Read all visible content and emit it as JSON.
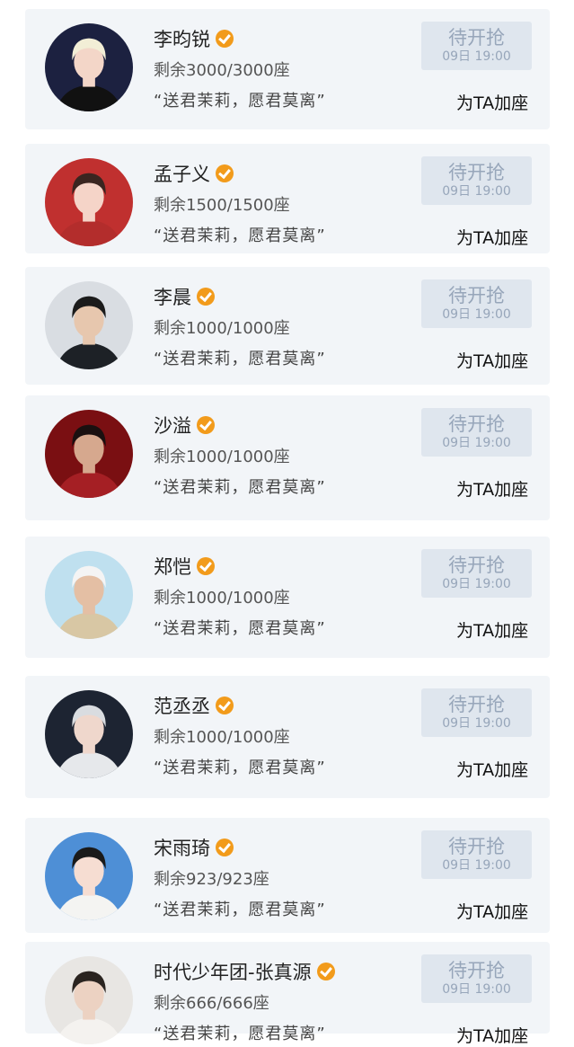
{
  "cards": [
    {
      "name": "李昀锐",
      "seats": "剩余3000/3000座",
      "quote": "“送君茉莉，愿君莫离”",
      "button": "待开抢",
      "time": "09日 19:00",
      "add": "为TA加座",
      "avatar": {
        "bg": "#1c2140",
        "hair": "#f2eed6",
        "skin": "#f3d6c8",
        "cloth": "#111111"
      }
    },
    {
      "name": "孟子义",
      "seats": "剩余1500/1500座",
      "quote": "“送君茉莉，愿君莫离”",
      "button": "待开抢",
      "time": "09日 19:00",
      "add": "为TA加座",
      "avatar": {
        "bg": "#c0302f",
        "hair": "#3a2520",
        "skin": "#f5d4c8",
        "cloth": "#b32d2c"
      }
    },
    {
      "name": "李晨",
      "seats": "剩余1000/1000座",
      "quote": "“送君茉莉，愿君莫离”",
      "button": "待开抢",
      "time": "09日 19:00",
      "add": "为TA加座",
      "avatar": {
        "bg": "#d9dde2",
        "hair": "#1b1b1b",
        "skin": "#e7c7ae",
        "cloth": "#1d2126"
      }
    },
    {
      "name": "沙溢",
      "seats": "剩余1000/1000座",
      "quote": "“送君茉莉，愿君莫离”",
      "button": "待开抢",
      "time": "09日 19:00",
      "add": "为TA加座",
      "avatar": {
        "bg": "#7a0f12",
        "hair": "#1a1010",
        "skin": "#d6a88e",
        "cloth": "#a51f24"
      }
    },
    {
      "name": "郑恺",
      "seats": "剩余1000/1000座",
      "quote": "“送君茉莉，愿君莫离”",
      "button": "待开抢",
      "time": "09日 19:00",
      "add": "为TA加座",
      "avatar": {
        "bg": "#bfe0ef",
        "hair": "#f4f4f4",
        "skin": "#e4bfa4",
        "cloth": "#d8c7a4"
      }
    },
    {
      "name": "范丞丞",
      "seats": "剩余1000/1000座",
      "quote": "“送君茉莉，愿君莫离”",
      "button": "待开抢",
      "time": "09日 19:00",
      "add": "为TA加座",
      "avatar": {
        "bg": "#1d2432",
        "hair": "#d9dce0",
        "skin": "#efd7cc",
        "cloth": "#e6e8eb"
      }
    },
    {
      "name": "宋雨琦",
      "seats": "剩余923/923座",
      "quote": "“送君茉莉，愿君莫离”",
      "button": "待开抢",
      "time": "09日 19:00",
      "add": "为TA加座",
      "avatar": {
        "bg": "#4e8fd6",
        "hair": "#1a1a1a",
        "skin": "#f6ddd2",
        "cloth": "#f4f4f2"
      }
    },
    {
      "name": "时代少年团-张真源",
      "seats": "剩余666/666座",
      "quote": "“送君茉莉，愿君莫离”",
      "button": "待开抢",
      "time": "09日 19:00",
      "add": "为TA加座",
      "avatar": {
        "bg": "#e8e6e3",
        "hair": "#2a2420",
        "skin": "#ecd2c2",
        "cloth": "#f4f2ef"
      }
    }
  ]
}
